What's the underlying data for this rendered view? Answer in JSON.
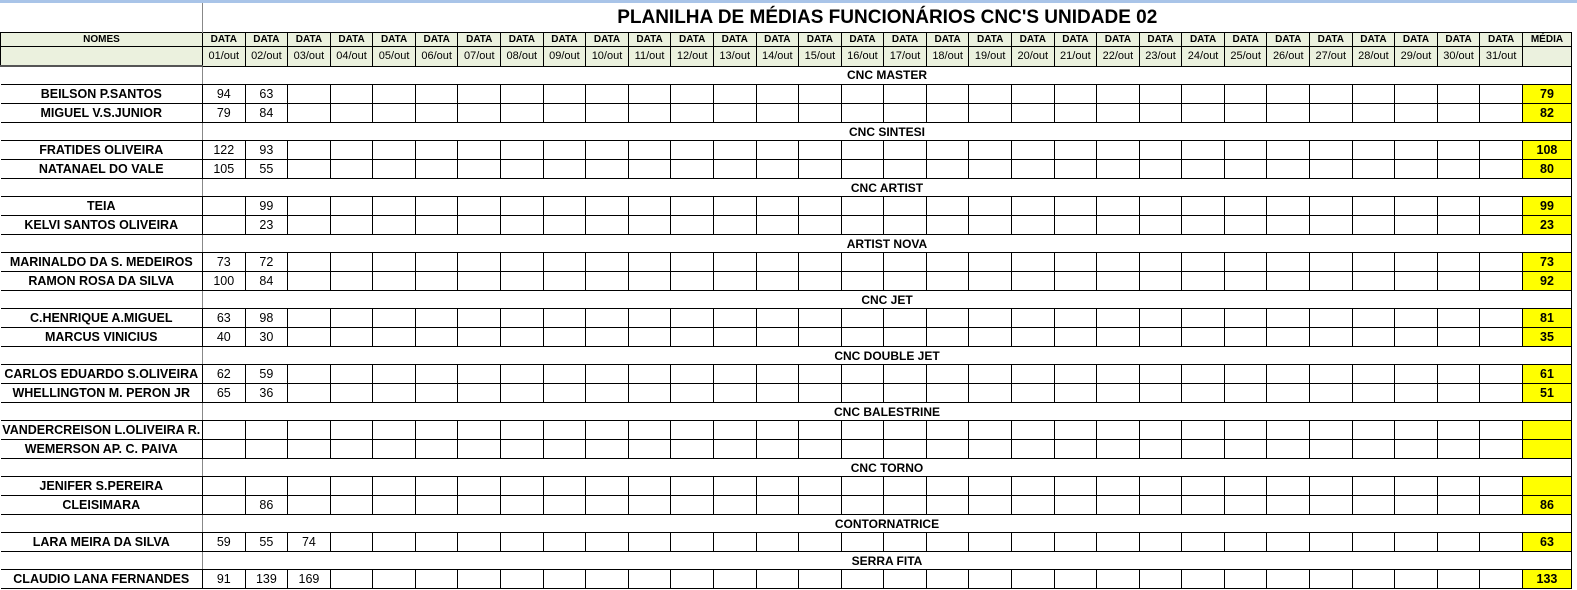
{
  "title": "PLANILHA DE MÉDIAS FUNCIONÁRIOS CNC'S UNIDADE 02",
  "header": {
    "names_label": "NOMES",
    "date_label": "DATA",
    "media_label": "MÉDIA",
    "dates": [
      "01/out",
      "02/out",
      "03/out",
      "04/out",
      "05/out",
      "06/out",
      "07/out",
      "08/out",
      "09/out",
      "10/out",
      "11/out",
      "12/out",
      "13/out",
      "14/out",
      "15/out",
      "16/out",
      "17/out",
      "18/out",
      "19/out",
      "20/out",
      "21/out",
      "22/out",
      "23/out",
      "24/out",
      "25/out",
      "26/out",
      "27/out",
      "28/out",
      "29/out",
      "30/out",
      "31/out"
    ]
  },
  "colors": {
    "header_bg": "#ebf1de",
    "media_bg": "#ffff00"
  },
  "sections": [
    {
      "name": "CNC MASTER",
      "rows": [
        {
          "name": "BEILSON P.SANTOS",
          "values": [
            "94",
            "63"
          ],
          "media": "79"
        },
        {
          "name": "MIGUEL V.S.JUNIOR",
          "values": [
            "79",
            "84"
          ],
          "media": "82"
        }
      ]
    },
    {
      "name": "CNC SINTESI",
      "rows": [
        {
          "name": "FRATIDES OLIVEIRA",
          "values": [
            "122",
            "93"
          ],
          "media": "108"
        },
        {
          "name": "NATANAEL DO VALE",
          "values": [
            "105",
            "55"
          ],
          "media": "80"
        }
      ]
    },
    {
      "name": "CNC ARTIST",
      "rows": [
        {
          "name": "TEIA",
          "values": [
            "",
            "99"
          ],
          "media": "99"
        },
        {
          "name": "KELVI SANTOS OLIVEIRA",
          "values": [
            "",
            "23"
          ],
          "media": "23"
        }
      ]
    },
    {
      "name": "ARTIST NOVA",
      "rows": [
        {
          "name": "MARINALDO DA S. MEDEIROS",
          "values": [
            "73",
            "72"
          ],
          "media": "73"
        },
        {
          "name": "RAMON ROSA DA SILVA",
          "values": [
            "100",
            "84"
          ],
          "media": "92"
        }
      ]
    },
    {
      "name": "CNC JET",
      "rows": [
        {
          "name": "C.HENRIQUE A.MIGUEL",
          "values": [
            "63",
            "98"
          ],
          "media": "81"
        },
        {
          "name": "MARCUS VINICIUS",
          "values": [
            "40",
            "30"
          ],
          "media": "35"
        }
      ]
    },
    {
      "name": "CNC DOUBLE JET",
      "rows": [
        {
          "name": "CARLOS EDUARDO S.OLIVEIRA",
          "values": [
            "62",
            "59"
          ],
          "media": "61"
        },
        {
          "name": "WHELLINGTON M. PERON JR",
          "values": [
            "65",
            "36"
          ],
          "media": "51"
        }
      ]
    },
    {
      "name": "CNC BALESTRINE",
      "rows": [
        {
          "name": "VANDERCREISON L.OLIVEIRA R.",
          "values": [],
          "media": ""
        },
        {
          "name": "WEMERSON AP. C. PAIVA",
          "values": [],
          "media": ""
        }
      ]
    },
    {
      "name": "CNC TORNO",
      "rows": [
        {
          "name": "JENIFER S.PEREIRA",
          "values": [],
          "media": ""
        },
        {
          "name": "CLEISIMARA",
          "values": [
            "",
            "86"
          ],
          "media": "86"
        }
      ]
    },
    {
      "name": "CONTORNATRICE",
      "rows": [
        {
          "name": "LARA MEIRA DA SILVA",
          "values": [
            "59",
            "55",
            "74"
          ],
          "media": "63"
        }
      ]
    },
    {
      "name": "SERRA FITA",
      "rows": [
        {
          "name": "CLAUDIO LANA FERNANDES",
          "values": [
            "91",
            "139",
            "169"
          ],
          "media": "133"
        }
      ]
    }
  ]
}
